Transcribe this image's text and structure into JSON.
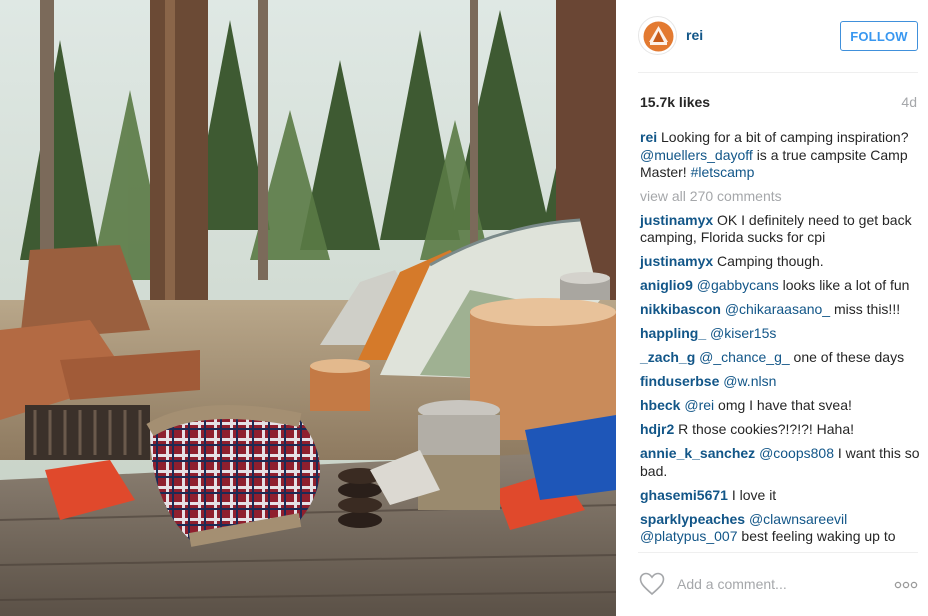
{
  "post": {
    "username": "rei",
    "follow_label": "FOLLOW",
    "likes": "15.7k likes",
    "age": "4d",
    "caption": {
      "user": "rei",
      "text_1": "Looking for a bit of camping inspiration?",
      "mention": "@muellers_dayoff",
      "text_2": "is a true campsite Camp Master!",
      "hashtag": "#letscamp"
    },
    "view_all": "view all 270 comments",
    "comments": [
      {
        "user": "justinamyx",
        "mention": "",
        "text": "OK I definitely need to get back camping, Florida sucks for cpi"
      },
      {
        "user": "justinamyx",
        "mention": "",
        "text": "Camping though."
      },
      {
        "user": "aniglio9",
        "mention": "@gabbycans",
        "text": "looks like a lot of fun"
      },
      {
        "user": "nikkibascon",
        "mention": "@chikaraasano_",
        "text": "miss this!!!"
      },
      {
        "user": "happling_",
        "mention": "@kiser15s",
        "text": ""
      },
      {
        "user": "_zach_g",
        "mention": "@_chance_g_",
        "text": "one of these days"
      },
      {
        "user": "finduserbse",
        "mention": "@w.nlsn",
        "text": ""
      },
      {
        "user": "hbeck",
        "mention": "@rei",
        "text": "omg I have that svea!"
      },
      {
        "user": "hdjr2",
        "mention": "",
        "text": "R those cookies?!?!?! Haha!"
      },
      {
        "user": "annie_k_sanchez",
        "mention": "@coops808",
        "text": "I want this so bad."
      },
      {
        "user": "ghasemi5671",
        "mention": "",
        "text": "I love it"
      },
      {
        "user": "sparklypeaches",
        "mention": "@clawnsareevil @platypus_007",
        "text": "best feeling waking up to"
      }
    ],
    "add_comment_placeholder": "Add a comment...",
    "more_label": "...",
    "icons": {
      "heart": "heart-outline-icon",
      "more": "more-dots-icon",
      "avatar": "rei-logo"
    }
  },
  "photo": {
    "description_icon": "camping-photo"
  }
}
